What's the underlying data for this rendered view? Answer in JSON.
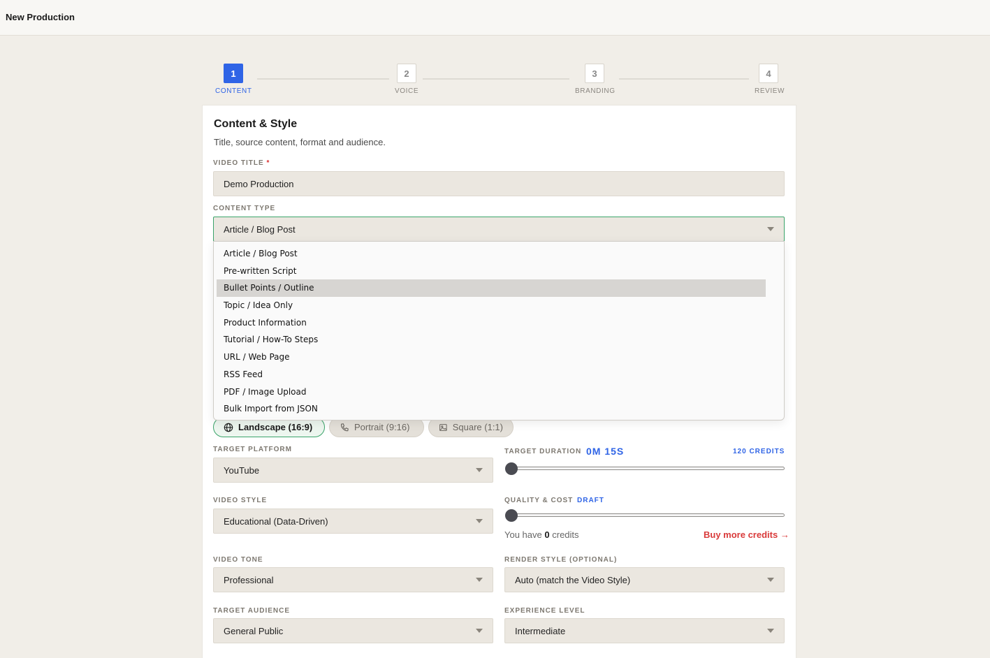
{
  "header": {
    "title": "New Production"
  },
  "stepper": {
    "steps": [
      {
        "number": "1",
        "label": "CONTENT"
      },
      {
        "number": "2",
        "label": "VOICE"
      },
      {
        "number": "3",
        "label": "BRANDING"
      },
      {
        "number": "4",
        "label": "REVIEW"
      }
    ],
    "active_step": 1
  },
  "card": {
    "title": "Content & Style",
    "subtitle": "Title, source content, format and audience."
  },
  "video_title": {
    "label": "VIDEO TITLE",
    "required_mark": "*",
    "value": "Demo Production"
  },
  "content_type": {
    "label": "CONTENT TYPE",
    "value": "Article / Blog Post",
    "options": [
      "Article / Blog Post",
      "Pre-written Script",
      "Bullet Points / Outline",
      "Topic / Idea Only",
      "Product Information",
      "Tutorial / How-To Steps",
      "URL / Web Page",
      "RSS Feed",
      "PDF / Image Upload",
      "Bulk Import from JSON"
    ],
    "highlighted_option": "Bullet Points / Outline"
  },
  "aspect_ratio": {
    "options": [
      {
        "label": "Landscape (16:9)",
        "icon": "globe-icon",
        "selected": true
      },
      {
        "label": "Portrait (9:16)",
        "icon": "phone-icon",
        "selected": false
      },
      {
        "label": "Square (1:1)",
        "icon": "image-icon",
        "selected": false
      }
    ]
  },
  "target_platform": {
    "label": "TARGET PLATFORM",
    "value": "YouTube"
  },
  "target_duration": {
    "label": "TARGET DURATION",
    "value": "0M 15S",
    "credits": "120 CREDITS",
    "slider_fraction": 0
  },
  "video_style": {
    "label": "VIDEO STYLE",
    "value": "Educational (Data-Driven)"
  },
  "quality_cost": {
    "label": "QUALITY & COST",
    "tier": "DRAFT",
    "slider_fraction": 0
  },
  "credits_info": {
    "prefix": "You have",
    "count": "0",
    "suffix": "credits",
    "buy_link": "Buy more credits →"
  },
  "video_tone": {
    "label": "VIDEO TONE",
    "value": "Professional"
  },
  "render_style": {
    "label": "RENDER STYLE (OPTIONAL)",
    "value": "Auto (match the Video Style)"
  },
  "target_audience": {
    "label": "TARGET AUDIENCE",
    "value": "General Public"
  },
  "experience_level": {
    "label": "EXPERIENCE LEVEL",
    "value": "Intermediate"
  },
  "colors": {
    "accent": "#2f64e6",
    "focus": "#3aa46a",
    "danger": "#d93a3a"
  }
}
